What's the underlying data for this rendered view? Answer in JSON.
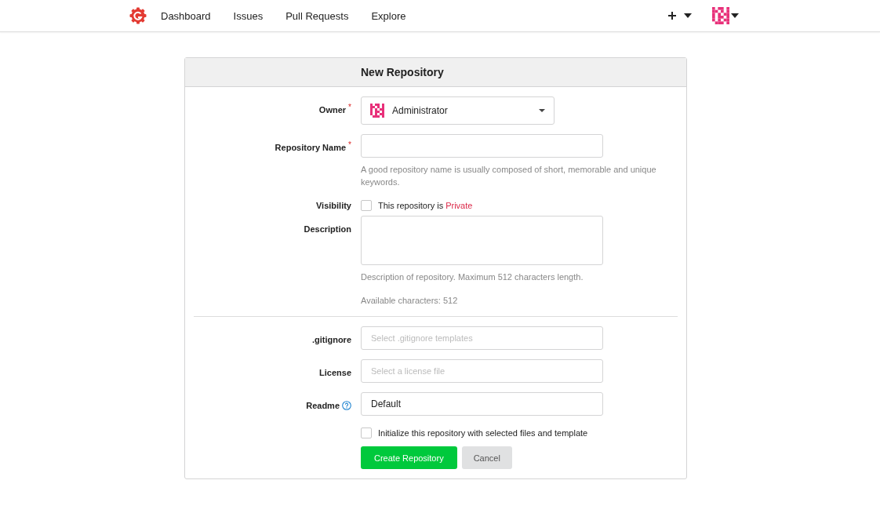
{
  "navbar": {
    "links": [
      {
        "label": "Dashboard"
      },
      {
        "label": "Issues"
      },
      {
        "label": "Pull Requests"
      },
      {
        "label": "Explore"
      }
    ]
  },
  "form": {
    "title": "New Repository",
    "fields": [
      {
        "kind": "owner",
        "label": "Owner",
        "required_mark": "*",
        "value": "Administrator"
      },
      {
        "kind": "text",
        "label": "Repository Name",
        "required_mark": "*",
        "help": "A good repository name is usually composed of short, memorable and unique keywords."
      },
      {
        "kind": "checkbox",
        "label": "Visibility",
        "checked": false,
        "text": "This repository is",
        "accent": "Private"
      },
      {
        "kind": "textarea",
        "label": "Description",
        "help": "Description of repository. Maximum 512 characters length.",
        "counter": "Available characters: 512"
      },
      {
        "kind": "divider"
      },
      {
        "kind": "select",
        "label": ".gitignore",
        "placeholder": "Select .gitignore templates"
      },
      {
        "kind": "select",
        "label": "License",
        "placeholder": "Select a license file"
      },
      {
        "kind": "select",
        "label": "Readme",
        "help_icon": true,
        "value": "Default"
      },
      {
        "kind": "checkbox",
        "checked": false,
        "text": "Initialize this repository with selected files and template"
      }
    ],
    "buttons": [
      {
        "kind": "primary",
        "label": "Create Repository"
      },
      {
        "kind": "secondary",
        "label": "Cancel"
      }
    ]
  }
}
